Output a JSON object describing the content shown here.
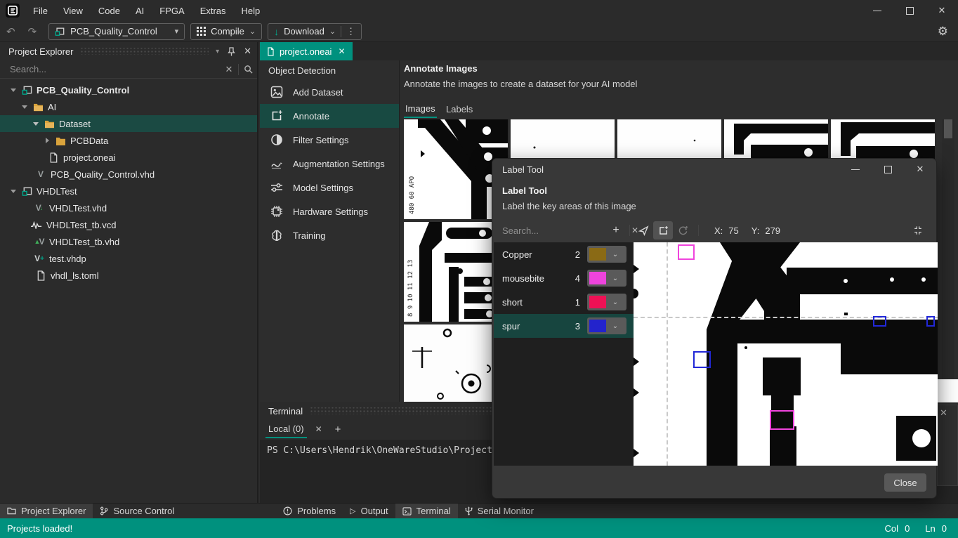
{
  "icons": {
    "close": "✕",
    "plus": "+",
    "kebab": "⋮",
    "dropdown": "▾",
    "chevron": "⌄",
    "undo": "↶",
    "redo": "↷",
    "gear": "⚙",
    "output_play": "▷"
  },
  "menu_bar": {
    "items": [
      "File",
      "View",
      "Code",
      "AI",
      "FPGA",
      "Extras",
      "Help"
    ]
  },
  "toolbar": {
    "project_selector": "PCB_Quality_Control",
    "compile": "Compile",
    "download": "Download"
  },
  "project_explorer": {
    "title": "Project Explorer",
    "search_placeholder": "Search...",
    "tree": [
      {
        "label": "PCB_Quality_Control"
      },
      {
        "label": "AI"
      },
      {
        "label": "Dataset"
      },
      {
        "label": "PCBData"
      },
      {
        "label": "project.oneai"
      },
      {
        "label": "PCB_Quality_Control.vhd"
      },
      {
        "label": "VHDLTest"
      },
      {
        "label": "VHDLTest.vhd"
      },
      {
        "label": "VHDLTest_tb.vcd"
      },
      {
        "label": "VHDLTest_tb.vhd"
      },
      {
        "label": "test.vhdp"
      },
      {
        "label": "vhdl_ls.toml"
      }
    ]
  },
  "editor": {
    "active_tab": "project.oneai",
    "sidebar_title": "Object Detection",
    "sidebar_items": [
      {
        "label": "Add Dataset"
      },
      {
        "label": "Annotate"
      },
      {
        "label": "Filter Settings"
      },
      {
        "label": "Augmentation Settings"
      },
      {
        "label": "Model Settings"
      },
      {
        "label": "Hardware Settings"
      },
      {
        "label": "Training"
      }
    ],
    "annotate_view": {
      "title": "Annotate Images",
      "subtitle": "Annotate the images to create a dataset for your AI model",
      "tabs": [
        {
          "label": "Images"
        },
        {
          "label": "Labels"
        }
      ]
    }
  },
  "terminal": {
    "panel_title": "Terminal",
    "tab_label": "Local (0)",
    "prompt": "PS C:\\Users\\Hendrik\\OneWareStudio\\Project"
  },
  "bottom_bar": {
    "left": [
      {
        "label": "Project Explorer"
      },
      {
        "label": "Source Control"
      }
    ],
    "right": [
      {
        "label": "Problems"
      },
      {
        "label": "Output"
      },
      {
        "label": "Terminal"
      },
      {
        "label": "Serial Monitor"
      }
    ]
  },
  "status_bar": {
    "message": "Projects loaded!",
    "col_label": "Col",
    "col_value": "0",
    "ln_label": "Ln",
    "ln_value": "0",
    "accent_color": "#00917e"
  },
  "label_tool": {
    "window_title": "Label Tool",
    "heading": "Label Tool",
    "subheading": "Label the key areas of this image",
    "search_placeholder": "Search...",
    "x_label": "X:",
    "x_value": "75",
    "y_label": "Y:",
    "y_value": "279",
    "labels": [
      {
        "name": "Copper",
        "count": "2",
        "color": "#8a6a15"
      },
      {
        "name": "mousebite",
        "count": "4",
        "color": "#ee44dd"
      },
      {
        "name": "short",
        "count": "1",
        "color": "#ee1155"
      },
      {
        "name": "spur",
        "count": "3",
        "color": "#2323cc"
      }
    ],
    "annotation_colors": {
      "mousebite": "#f044dd",
      "spur": "#2228d8"
    },
    "close_label": "Close"
  }
}
